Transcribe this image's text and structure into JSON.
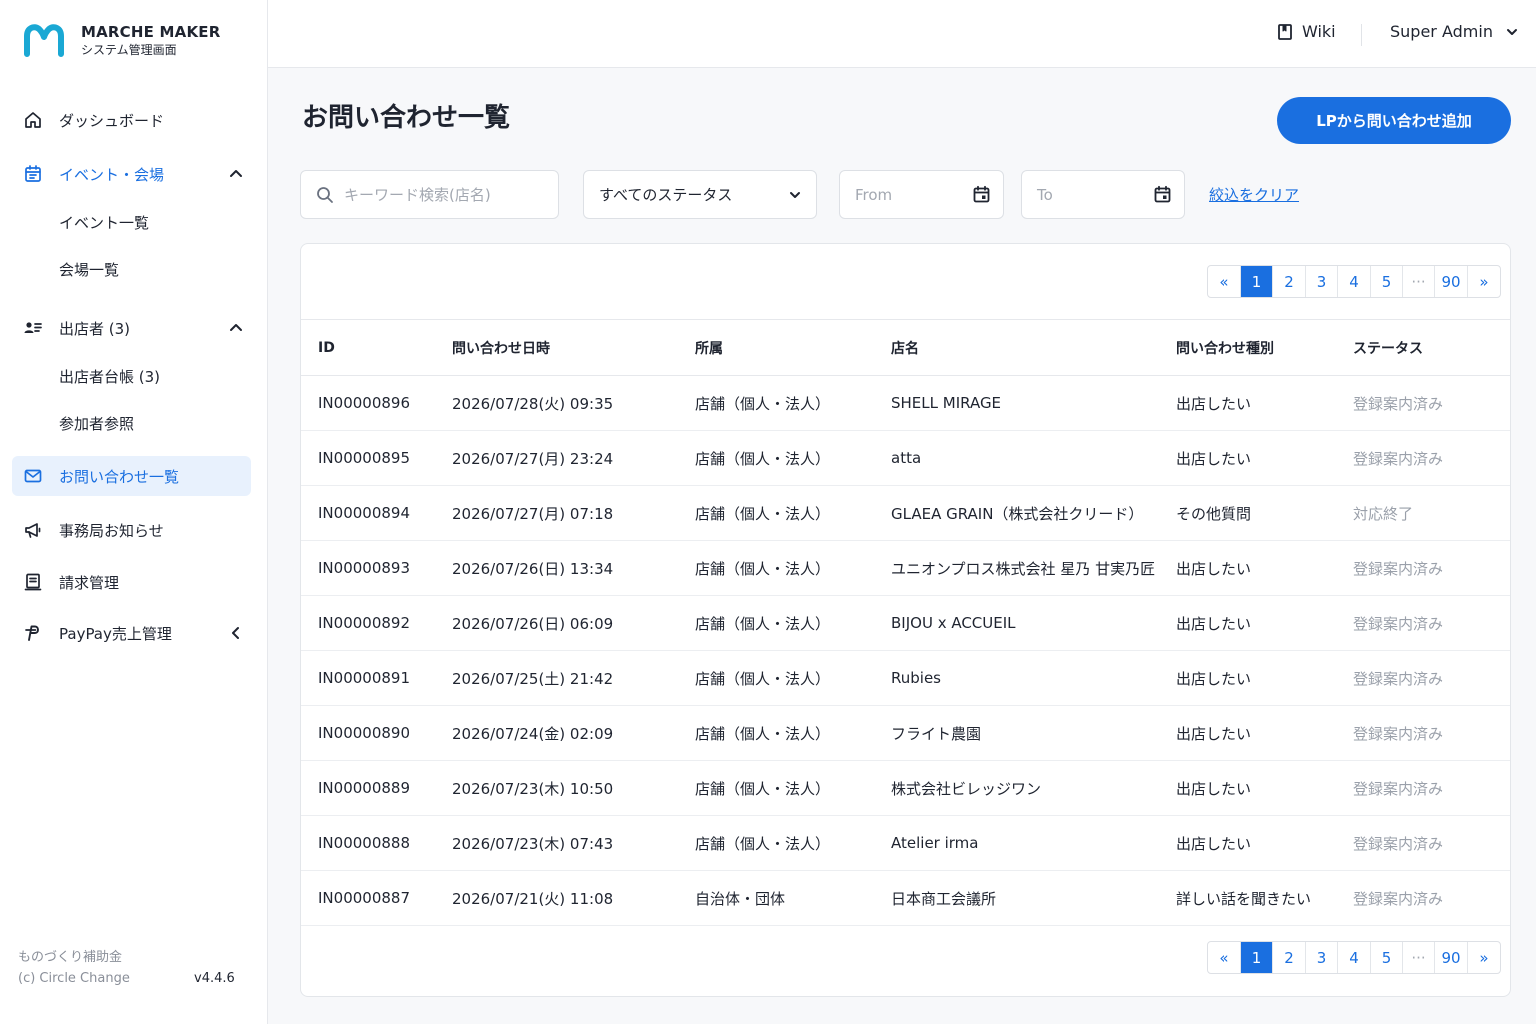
{
  "brand": {
    "title": "MARCHE MAKER",
    "subtitle": "システム管理画面",
    "logo_color": "#1aa8d4"
  },
  "sidebar": {
    "items": [
      {
        "label": "ダッシュボード",
        "icon": "home-icon"
      },
      {
        "label": "イベント・会場",
        "icon": "calendar-icon",
        "expanded": true
      },
      {
        "label": "イベント一覧"
      },
      {
        "label": "会場一覧"
      },
      {
        "label": "出店者 (3)",
        "icon": "users-icon",
        "expanded": true
      },
      {
        "label": "出店者台帳 (3)"
      },
      {
        "label": "参加者参照"
      },
      {
        "label": "お問い合わせ一覧",
        "icon": "mail-icon",
        "active": true
      },
      {
        "label": "事務局お知らせ",
        "icon": "megaphone-icon"
      },
      {
        "label": "請求管理",
        "icon": "invoice-icon"
      },
      {
        "label": "PayPay売上管理",
        "icon": "paypay-icon",
        "expanded": false
      }
    ],
    "footer": {
      "line1": "ものづくり補助金",
      "line2": "(c) Circle Change",
      "version": "v4.4.6"
    }
  },
  "topbar": {
    "wiki_label": "Wiki",
    "user_label": "Super Admin"
  },
  "page": {
    "title": "お問い合わせ一覧",
    "add_button": "LPから問い合わせ追加"
  },
  "filters": {
    "search_placeholder": "キーワード検索(店名)",
    "status_value": "すべてのステータス",
    "from_placeholder": "From",
    "to_placeholder": "To",
    "clear_label": "絞込をクリア"
  },
  "pagination": {
    "first": "«",
    "pages": [
      "1",
      "2",
      "3",
      "4",
      "5"
    ],
    "ellipsis": "···",
    "last_page": "90",
    "next": "»",
    "current": "1"
  },
  "table": {
    "headers": [
      "ID",
      "問い合わせ日時",
      "所属",
      "店名",
      "問い合わせ種別",
      "ステータス"
    ],
    "rows": [
      [
        "IN00000896",
        "2026/07/28(火) 09:35",
        "店舗（個人・法人）",
        "SHELL MIRAGE",
        "出店したい",
        "登録案内済み"
      ],
      [
        "IN00000895",
        "2026/07/27(月) 23:24",
        "店舗（個人・法人）",
        "atta",
        "出店したい",
        "登録案内済み"
      ],
      [
        "IN00000894",
        "2026/07/27(月) 07:18",
        "店舗（個人・法人）",
        "GLAEA GRAIN（株式会社クリード）",
        "その他質問",
        "対応終了"
      ],
      [
        "IN00000893",
        "2026/07/26(日) 13:34",
        "店舗（個人・法人）",
        "ユニオンプロス株式会社 星乃 甘実乃匠",
        "出店したい",
        "登録案内済み"
      ],
      [
        "IN00000892",
        "2026/07/26(日) 06:09",
        "店舗（個人・法人）",
        "BIJOU x ACCUEIL",
        "出店したい",
        "登録案内済み"
      ],
      [
        "IN00000891",
        "2026/07/25(土) 21:42",
        "店舗（個人・法人）",
        "Rubies",
        "出店したい",
        "登録案内済み"
      ],
      [
        "IN00000890",
        "2026/07/24(金) 02:09",
        "店舗（個人・法人）",
        "フライト農園",
        "出店したい",
        "登録案内済み"
      ],
      [
        "IN00000889",
        "2026/07/23(木) 10:50",
        "店舗（個人・法人）",
        "株式会社ビレッジワン",
        "出店したい",
        "登録案内済み"
      ],
      [
        "IN00000888",
        "2026/07/23(木) 07:43",
        "店舗（個人・法人）",
        "Atelier irma",
        "出店したい",
        "登録案内済み"
      ],
      [
        "IN00000887",
        "2026/07/21(火) 11:08",
        "自治体・団体",
        "日本商工会議所",
        "詳しい話を聞きたい",
        "登録案内済み"
      ]
    ]
  },
  "colors": {
    "accent": "#1a6fe0",
    "active_bg": "#e8f1fd",
    "status_text": "#9aa0aa"
  }
}
